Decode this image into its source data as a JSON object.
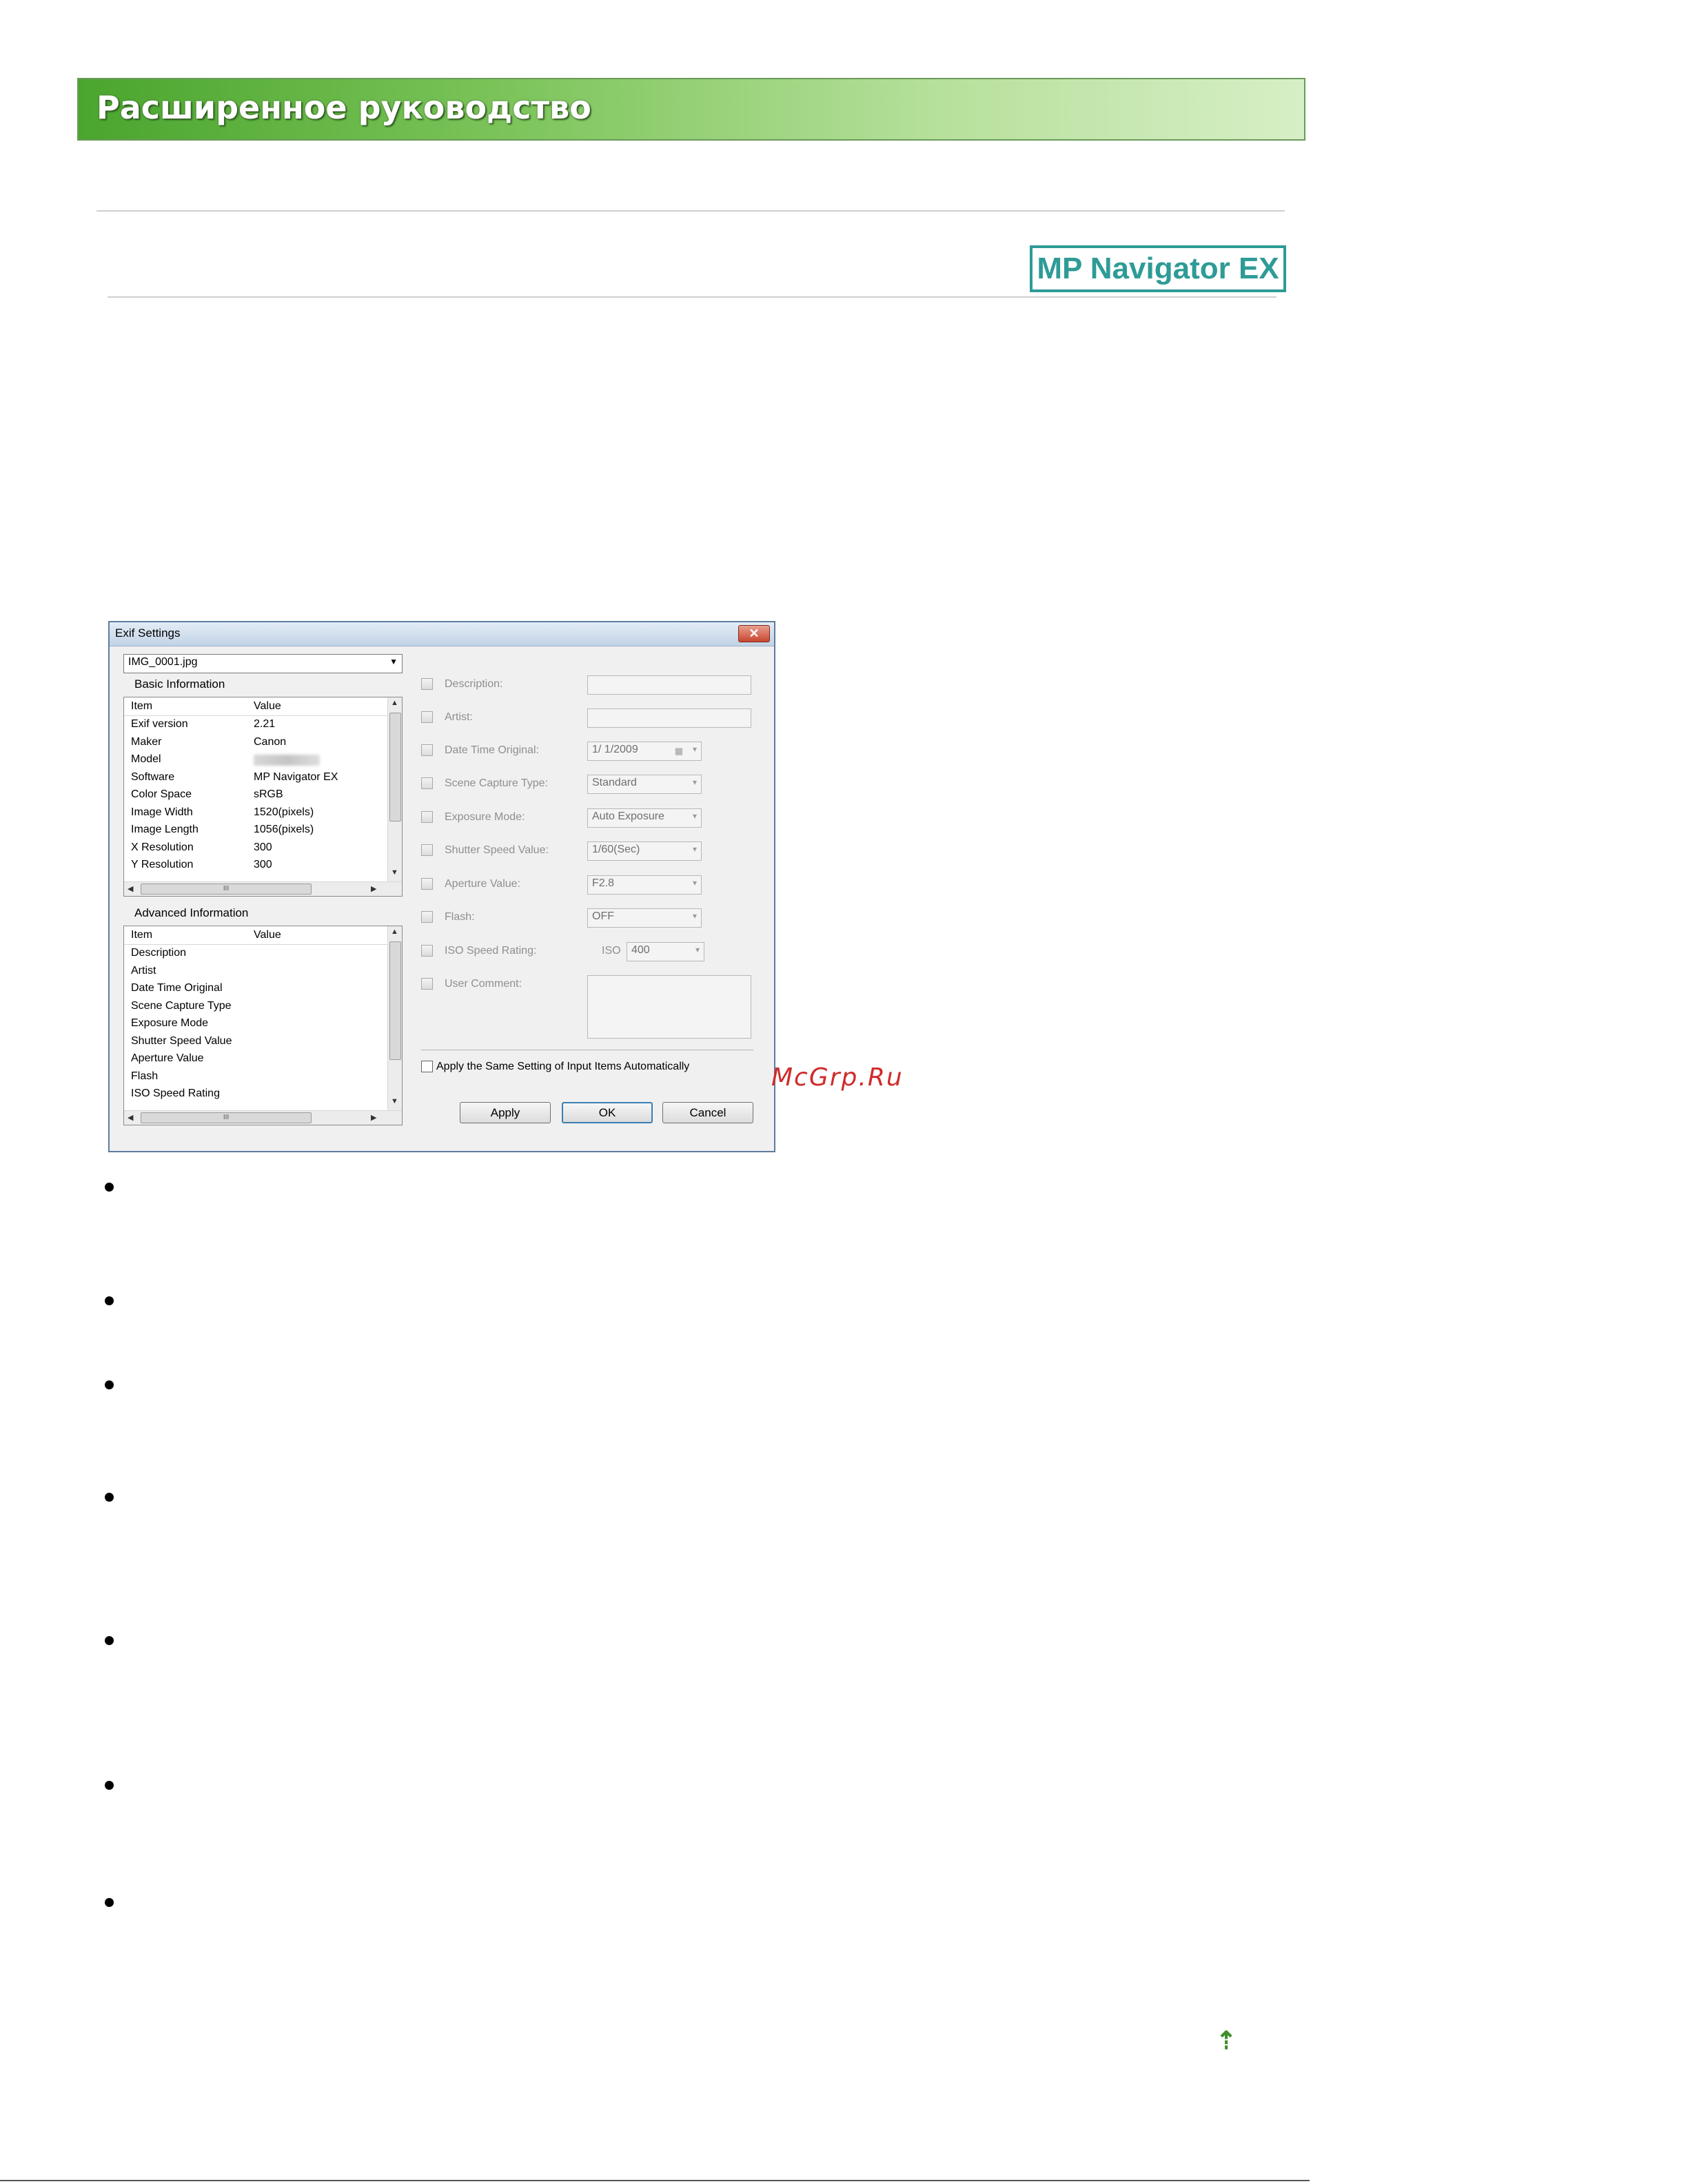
{
  "header": {
    "title": "Расширенное руководство"
  },
  "logo": {
    "text": "MP Navigator EX"
  },
  "dialog": {
    "title": "Exif Settings",
    "close_glyph": "✕",
    "file_select": "IMG_0001.jpg",
    "basic_group": "Basic Information",
    "advanced_group": "Advanced Information",
    "columns": {
      "item": "Item",
      "value": "Value"
    },
    "basic_rows": [
      {
        "item": "Exif version",
        "value": "2.21"
      },
      {
        "item": "Maker",
        "value": "Canon"
      },
      {
        "item": "Model",
        "value": ""
      },
      {
        "item": "Software",
        "value": "MP Navigator EX"
      },
      {
        "item": "Color Space",
        "value": "sRGB"
      },
      {
        "item": "Image Width",
        "value": "1520(pixels)"
      },
      {
        "item": "Image Length",
        "value": "1056(pixels)"
      },
      {
        "item": "X Resolution",
        "value": "300"
      },
      {
        "item": "Y Resolution",
        "value": "300"
      }
    ],
    "advanced_rows": [
      {
        "item": "Description"
      },
      {
        "item": "Artist"
      },
      {
        "item": "Date Time Original"
      },
      {
        "item": "Scene Capture Type"
      },
      {
        "item": "Exposure Mode"
      },
      {
        "item": "Shutter Speed Value"
      },
      {
        "item": "Aperture Value"
      },
      {
        "item": "Flash"
      },
      {
        "item": "ISO Speed Rating"
      }
    ],
    "scroll_grip": "III",
    "fields": {
      "description": {
        "label": "Description:",
        "value": ""
      },
      "artist": {
        "label": "Artist:",
        "value": ""
      },
      "date_time_original": {
        "label": "Date Time Original:",
        "value": "1/  1/2009"
      },
      "scene_capture_type": {
        "label": "Scene Capture Type:",
        "value": "Standard"
      },
      "exposure_mode": {
        "label": "Exposure Mode:",
        "value": "Auto Exposure"
      },
      "shutter_speed_value": {
        "label": "Shutter Speed Value:",
        "value": "1/60(Sec)"
      },
      "aperture_value": {
        "label": "Aperture Value:",
        "value": "F2.8"
      },
      "flash": {
        "label": "Flash:",
        "value": "OFF"
      },
      "iso_speed_rating": {
        "label": "ISO Speed Rating:",
        "prefix": "ISO",
        "value": "400"
      },
      "user_comment": {
        "label": "User Comment:",
        "value": ""
      }
    },
    "apply_same_setting": {
      "label": "Apply the Same Setting of Input Items Automatically",
      "checked": false
    },
    "buttons": {
      "apply": "Apply",
      "ok": "OK",
      "cancel": "Cancel"
    }
  },
  "watermark": "McGrp.Ru",
  "top_link_glyph": "⇡",
  "colors": {
    "header_green": "#4aa52e",
    "logo_teal": "#2e9b96",
    "watermark_red": "#d02b2b"
  }
}
